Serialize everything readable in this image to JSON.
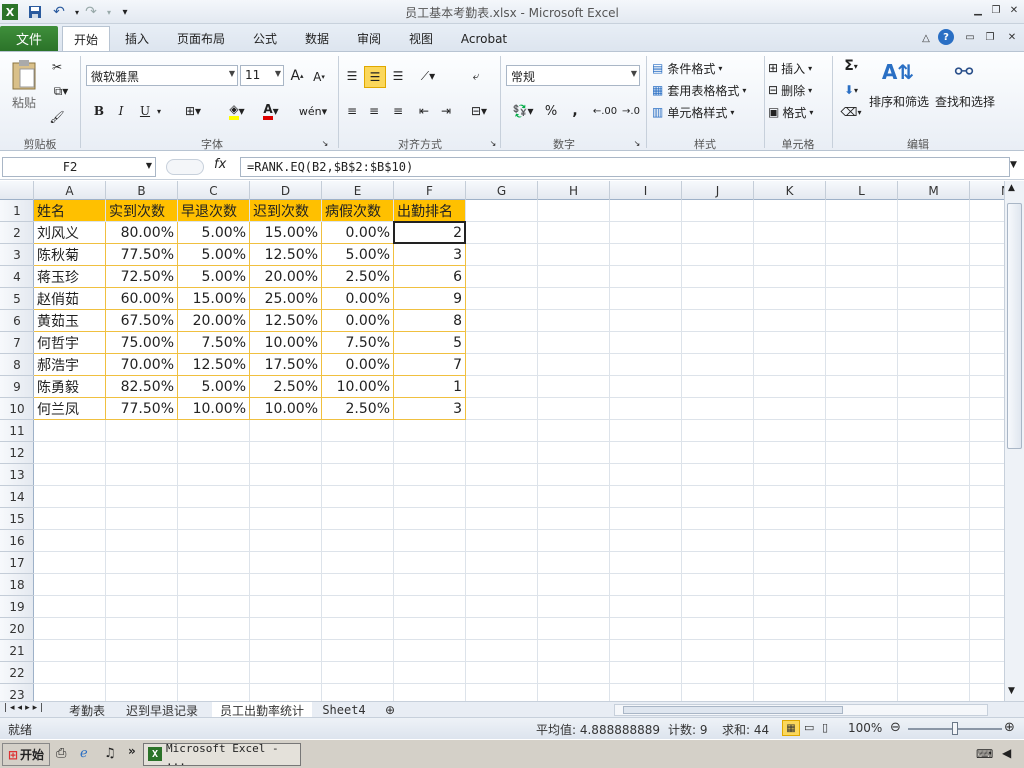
{
  "window": {
    "title": "员工基本考勤表.xlsx - Microsoft Excel"
  },
  "tabs": [
    {
      "label": "文件"
    },
    {
      "label": "开始"
    },
    {
      "label": "插入"
    },
    {
      "label": "页面布局"
    },
    {
      "label": "公式"
    },
    {
      "label": "数据"
    },
    {
      "label": "审阅"
    },
    {
      "label": "视图"
    },
    {
      "label": "Acrobat"
    }
  ],
  "ribbon": {
    "clipboard": {
      "paste": "粘贴",
      "label": "剪贴板"
    },
    "font": {
      "name": "微软雅黑",
      "size": "11",
      "bold": "B",
      "italic": "I",
      "underline": "U",
      "label": "字体"
    },
    "alignment": {
      "label": "对齐方式"
    },
    "number": {
      "format": "常规",
      "percent": "%",
      "comma": ",",
      "inc_dec": ".00",
      "label": "数字"
    },
    "styles": {
      "conditional": "条件格式",
      "table": "套用表格格式",
      "cell": "单元格样式",
      "label": "样式"
    },
    "cells": {
      "insert": "插入",
      "delete": "删除",
      "format": "格式",
      "label": "单元格"
    },
    "editing": {
      "sort": "排序和筛选",
      "find": "查找和选择",
      "sigma": "Σ",
      "label": "编辑"
    }
  },
  "formula_bar": {
    "name_box": "F2",
    "fx": "fx",
    "formula": "=RANK.EQ(B2,$B$2:$B$10)"
  },
  "columns": [
    "A",
    "B",
    "C",
    "D",
    "E",
    "F",
    "G",
    "H",
    "I",
    "J",
    "K",
    "L",
    "M",
    "N"
  ],
  "rows": [
    "1",
    "2",
    "3",
    "4",
    "5",
    "6",
    "7",
    "8",
    "9",
    "10",
    "11",
    "12",
    "13",
    "14",
    "15",
    "16",
    "17",
    "18",
    "19",
    "20",
    "21",
    "22",
    "23"
  ],
  "table": {
    "headers": [
      "姓名",
      "实到次数",
      "早退次数",
      "迟到次数",
      "病假次数",
      "出勤排名"
    ],
    "rows": [
      [
        "刘风义",
        "80.00%",
        "5.00%",
        "15.00%",
        "0.00%",
        "2"
      ],
      [
        "陈秋菊",
        "77.50%",
        "5.00%",
        "12.50%",
        "5.00%",
        "3"
      ],
      [
        "蒋玉珍",
        "72.50%",
        "5.00%",
        "20.00%",
        "2.50%",
        "6"
      ],
      [
        "赵俏茹",
        "60.00%",
        "15.00%",
        "25.00%",
        "0.00%",
        "9"
      ],
      [
        "黄茹玉",
        "67.50%",
        "20.00%",
        "12.50%",
        "0.00%",
        "8"
      ],
      [
        "何哲宇",
        "75.00%",
        "7.50%",
        "10.00%",
        "7.50%",
        "5"
      ],
      [
        "郝浩宇",
        "70.00%",
        "12.50%",
        "17.50%",
        "0.00%",
        "7"
      ],
      [
        "陈勇毅",
        "82.50%",
        "5.00%",
        "2.50%",
        "10.00%",
        "1"
      ],
      [
        "何兰凤",
        "77.50%",
        "10.00%",
        "10.00%",
        "2.50%",
        "3"
      ]
    ]
  },
  "sheets": [
    {
      "label": "考勤表"
    },
    {
      "label": "迟到早退记录"
    },
    {
      "label": "员工出勤率统计"
    },
    {
      "label": "Sheet4"
    }
  ],
  "status": {
    "ready": "就绪",
    "average": "平均值: 4.888888889",
    "count": "计数: 9",
    "sum": "求和: 44",
    "zoom": "100%",
    "zoom_level_percent": 100
  },
  "taskbar": {
    "start": "开始",
    "item": "Microsoft Excel - ...",
    "chevron": "»"
  },
  "colors": {
    "header_fill": "#ffc000",
    "file_tab": "#2b7329"
  }
}
